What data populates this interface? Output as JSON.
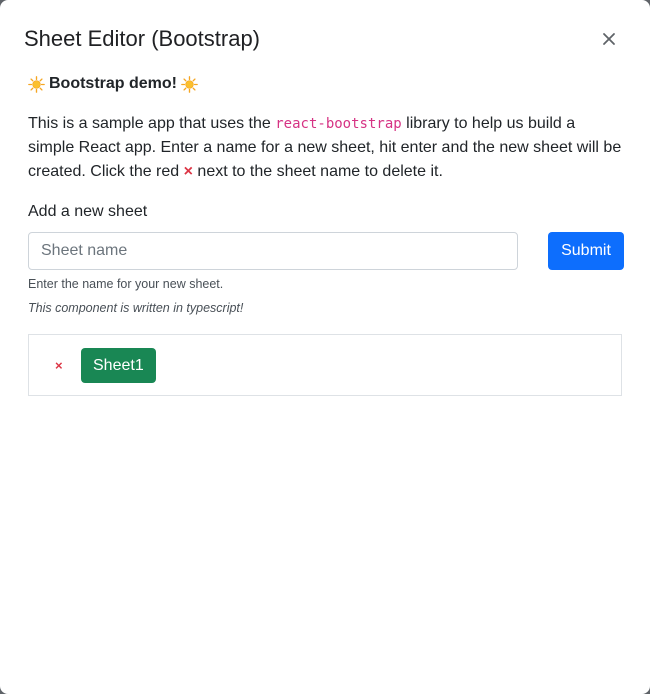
{
  "dialog": {
    "title": "Sheet Editor (Bootstrap)",
    "close_icon": "close-icon"
  },
  "demo": {
    "heading": "Bootstrap demo!",
    "icon": "sun-icon"
  },
  "description": {
    "part1": "This is a sample app that uses the ",
    "code": "react-bootstrap",
    "part2": " library to help us build a simple React app. Enter a name for a new sheet, hit enter and the new sheet will be created. Click the red ",
    "x_mark": "×",
    "part3": " next to the sheet name to delete it."
  },
  "form": {
    "label": "Add a new sheet",
    "placeholder": "Sheet name",
    "value": "",
    "submit_label": "Submit",
    "help_text": "Enter the name for your new sheet.",
    "note": "This component is written in typescript!"
  },
  "sheets": [
    {
      "delete_label": "×",
      "name": "Sheet1"
    }
  ],
  "colors": {
    "primary": "#0d6efd",
    "success": "#198754",
    "danger": "#dc3545",
    "code": "#d63384"
  }
}
